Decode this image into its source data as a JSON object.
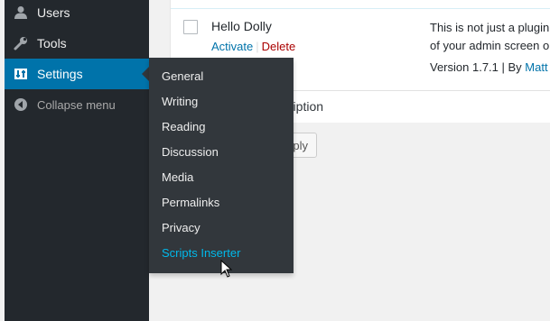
{
  "sidebar": {
    "items": [
      {
        "label": "Users",
        "icon": "user-icon"
      },
      {
        "label": "Tools",
        "icon": "wrench-icon"
      },
      {
        "label": "Settings",
        "icon": "settings-icon"
      },
      {
        "label": "Collapse menu",
        "icon": "collapse-icon"
      }
    ]
  },
  "settings_submenu": {
    "items": [
      "General",
      "Writing",
      "Reading",
      "Discussion",
      "Media",
      "Permalinks",
      "Privacy",
      "Scripts Inserter"
    ],
    "hovered": "Scripts Inserter"
  },
  "plugin": {
    "name": "Hello Dolly",
    "activate_label": "Activate",
    "separator": "|",
    "delete_label": "Delete",
    "description_line1": "This is not just a plugin,",
    "description_line2": "of your admin screen on",
    "version_text": "Version 1.7.1 | By ",
    "author": "Matt"
  },
  "table": {
    "description_header": "Description"
  },
  "bulk_actions": {
    "apply_label": "ply"
  },
  "colors": {
    "sidebar_bg": "#23282d",
    "flyout_bg": "#32373c",
    "active_blue": "#0073aa",
    "hover_cyan": "#00b9eb",
    "delete_red": "#a00"
  }
}
